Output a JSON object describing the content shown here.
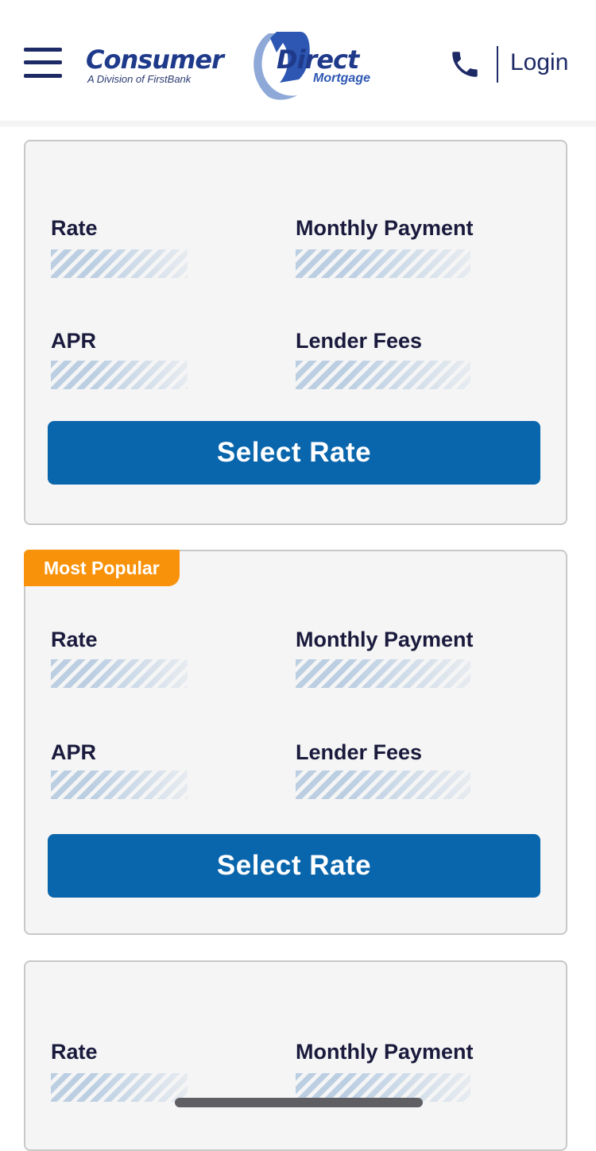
{
  "header": {
    "brand_name_part1": "Consumer",
    "brand_name_part2": "Direct",
    "brand_tagline": "A Division of FirstBank",
    "brand_sub": "Mortgage",
    "login_label": "Login"
  },
  "cards": [
    {
      "badge": "",
      "rate_label": "Rate",
      "monthly_payment_label": "Monthly Payment",
      "apr_label": "APR",
      "lender_fees_label": "Lender Fees",
      "button_label": "Select Rate"
    },
    {
      "badge": "Most Popular",
      "rate_label": "Rate",
      "monthly_payment_label": "Monthly Payment",
      "apr_label": "APR",
      "lender_fees_label": "Lender Fees",
      "button_label": "Select Rate"
    },
    {
      "badge": "",
      "rate_label": "Rate",
      "monthly_payment_label": "Monthly Payment"
    }
  ],
  "colors": {
    "navy": "#1e2a66",
    "button_blue": "#0a66ac",
    "badge_orange": "#f8920a",
    "card_bg": "#f5f5f5",
    "skeleton": "#b9cde2"
  },
  "icons": {
    "menu": "hamburger-icon",
    "phone": "phone-icon"
  }
}
